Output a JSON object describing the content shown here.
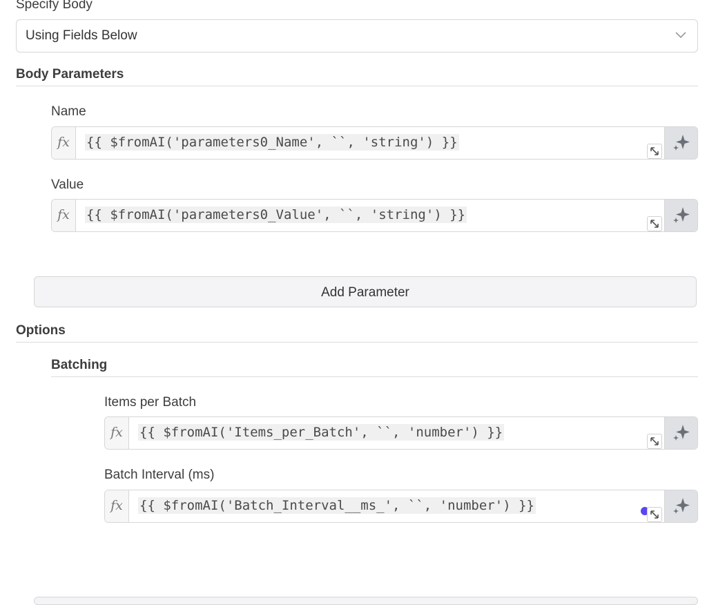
{
  "body": {
    "specify_label": "Specify Body",
    "specify_value": "Using Fields Below"
  },
  "body_parameters": {
    "title": "Body Parameters",
    "name_label": "Name",
    "name_expression": "{{ $fromAI('parameters0_Name', ``, 'string') }}",
    "value_label": "Value",
    "value_expression": "{{ $fromAI('parameters0_Value', ``, 'string') }}",
    "add_button": "Add Parameter"
  },
  "options": {
    "title": "Options",
    "batching": {
      "title": "Batching",
      "items_label": "Items per Batch",
      "items_expression": "{{ $fromAI('Items_per_Batch', ``, 'number') }}",
      "interval_label": "Batch Interval (ms)",
      "interval_expression": "{{ $fromAI('Batch_Interval__ms_', ``, 'number') }}"
    }
  },
  "icons": {
    "fx": "fx",
    "expand": "expand-icon",
    "ai": "sparkles-icon",
    "dropdown": "chevron-down-icon"
  },
  "colors": {
    "accent_dot": "#5b47f0",
    "ai_button_bg": "#dfe1e5"
  }
}
